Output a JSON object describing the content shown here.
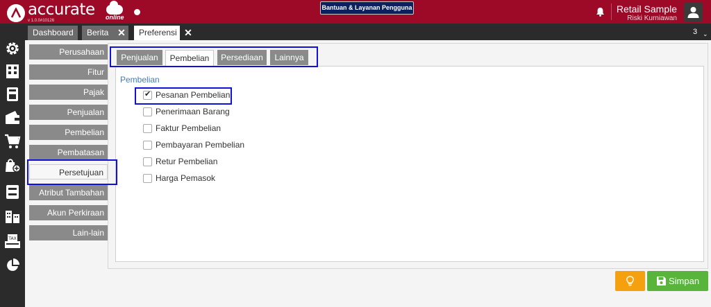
{
  "header": {
    "brand": "accurate",
    "brand_sub": "online",
    "version": "v 1.0.0#10126",
    "help_button": "Bantuan & Layanan Pengguna",
    "user_name": "Retail Sample",
    "user_sub": "Riski Kurniawan",
    "accent_color": "#9c0a28"
  },
  "tabs": [
    {
      "label": "Dashboard"
    },
    {
      "label": "Berita"
    },
    {
      "label": "Preferensi"
    }
  ],
  "tab_count": "3",
  "sidebar_icons": [
    "settings-gear-icon",
    "building-icon",
    "calculator-icon",
    "wallet-icon",
    "cart-icon",
    "shopping-bag-plus-icon",
    "archive-icon",
    "buildings-icon",
    "tax-icon",
    "pie-chart-icon"
  ],
  "nav": {
    "items": [
      {
        "label": "Perusahaan"
      },
      {
        "label": "Fitur"
      },
      {
        "label": "Pajak"
      },
      {
        "label": "Penjualan"
      },
      {
        "label": "Pembelian"
      },
      {
        "label": "Pembatasan"
      },
      {
        "label": "Persetujuan"
      },
      {
        "label": "Atribut Tambahan"
      },
      {
        "label": "Akun Perkiraan"
      },
      {
        "label": "Lain-lain"
      }
    ],
    "active": "Persetujuan"
  },
  "subtabs": [
    {
      "label": "Penjualan"
    },
    {
      "label": "Pembelian"
    },
    {
      "label": "Persediaan"
    },
    {
      "label": "Lainnya"
    }
  ],
  "active_subtab": "Pembelian",
  "section_title": "Pembelian",
  "options": [
    {
      "label": "Pesanan Pembelian",
      "checked": true
    },
    {
      "label": "Penerimaan Barang",
      "checked": false
    },
    {
      "label": "Faktur Pembelian",
      "checked": false
    },
    {
      "label": "Pembayaran Pembelian",
      "checked": false
    },
    {
      "label": "Retur Pembelian",
      "checked": false
    },
    {
      "label": "Harga Pemasok",
      "checked": false
    }
  ],
  "save_button": "Simpan"
}
